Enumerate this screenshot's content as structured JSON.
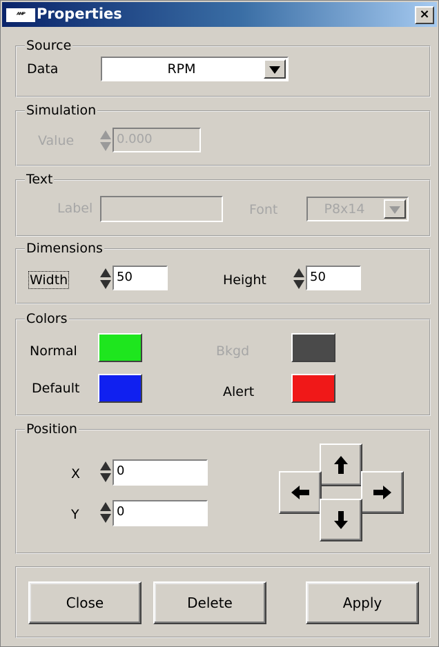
{
  "window": {
    "title": "Properties",
    "icon_text": "ᴬᴺᴾ",
    "close_symbol": "×"
  },
  "source": {
    "legend": "Source",
    "data_label": "Data",
    "data_value": "RPM"
  },
  "simulation": {
    "legend": "Simulation",
    "value_label": "Value",
    "value": "0.000"
  },
  "text": {
    "legend": "Text",
    "label_label": "Label",
    "label_value": "",
    "font_label": "Font",
    "font_value": "P8x14"
  },
  "dimensions": {
    "legend": "Dimensions",
    "width_label": "Width",
    "width_value": "50",
    "height_label": "Height",
    "height_value": "50"
  },
  "colors": {
    "legend": "Colors",
    "normal_label": "Normal",
    "normal_color": "#1ee61e",
    "bkgd_label": "Bkgd",
    "bkgd_color": "#4a4a4a",
    "default_label": "Default",
    "default_color": "#1020f0",
    "alert_label": "Alert",
    "alert_color": "#f01818"
  },
  "position": {
    "legend": "Position",
    "x_label": "X",
    "x_value": "0",
    "y_label": "Y",
    "y_value": "0"
  },
  "buttons": {
    "close": "Close",
    "delete": "Delete",
    "apply": "Apply"
  }
}
